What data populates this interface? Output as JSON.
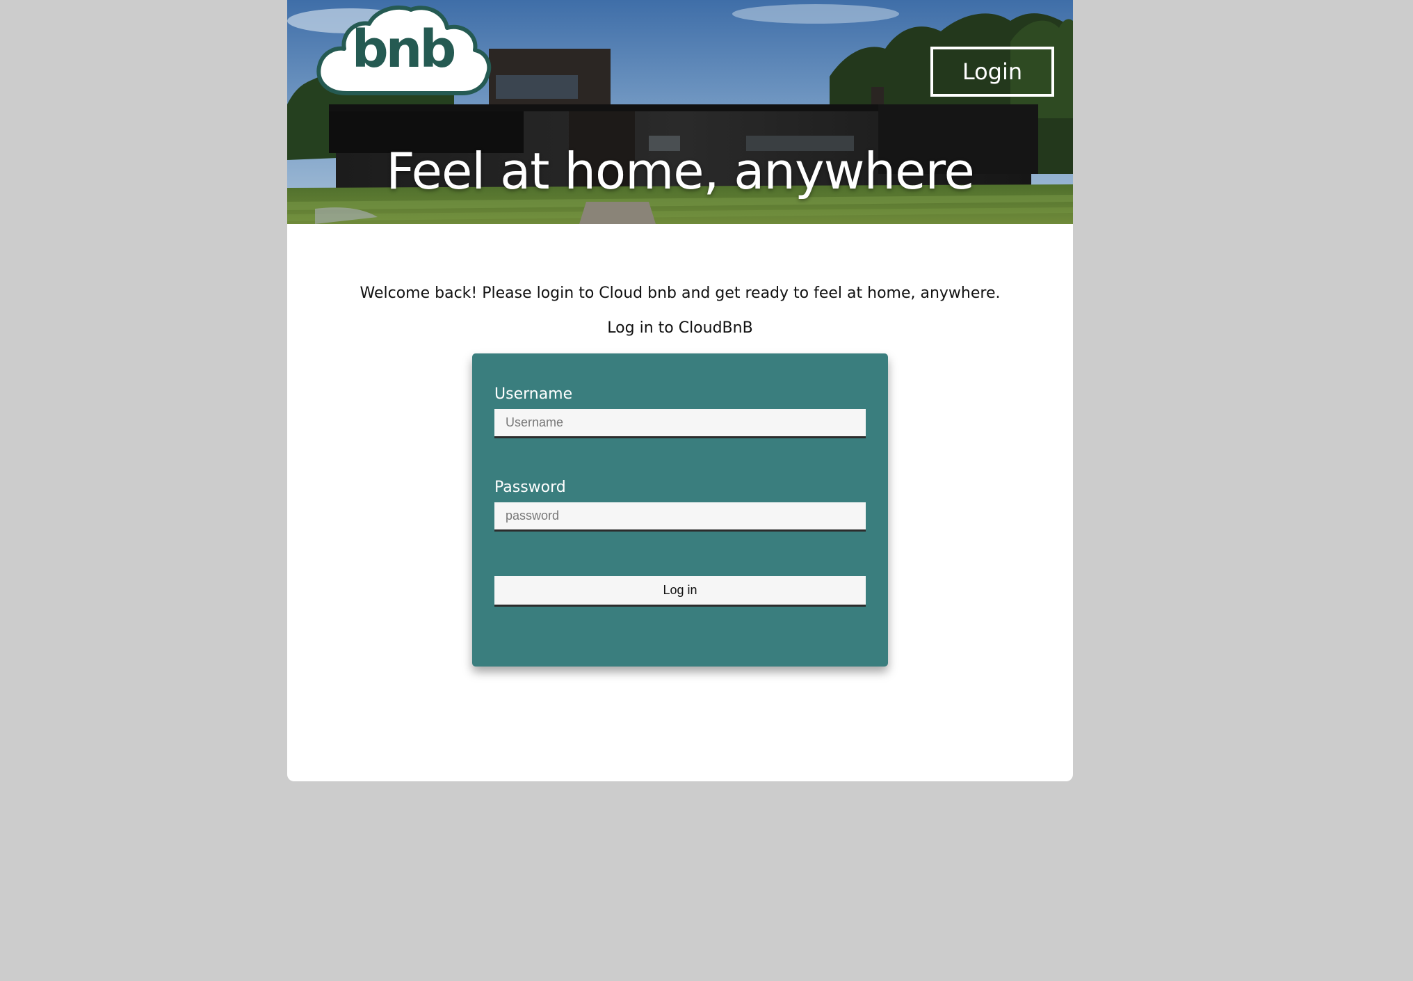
{
  "header": {
    "logo_text": "bnb",
    "login_label": "Login",
    "tagline": "Feel at home, anywhere"
  },
  "main": {
    "welcome_text": "Welcome back! Please login to Cloud bnb and get ready to feel at home, anywhere.",
    "subheading": "Log in to CloudBnB"
  },
  "form": {
    "username_label": "Username",
    "username_placeholder": "Username",
    "username_value": "",
    "password_label": "Password",
    "password_placeholder": "password",
    "password_value": "",
    "submit_label": "Log in"
  },
  "colors": {
    "page_background": "#cccccc",
    "card_background": "#3a7e7e",
    "logo_green": "#255a52",
    "input_background": "#f6f6f6"
  }
}
